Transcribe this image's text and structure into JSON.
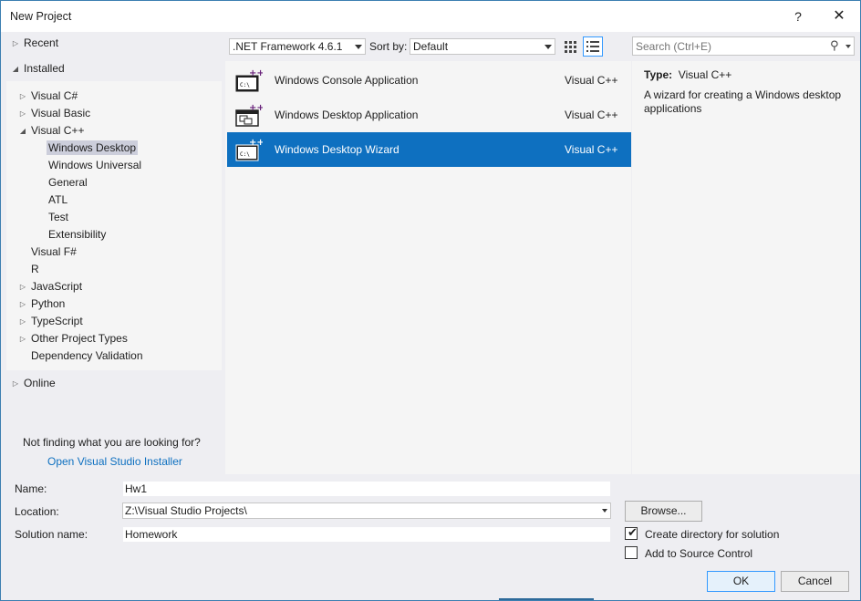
{
  "window": {
    "title": "New Project",
    "help_label": "?",
    "close_label": "✕"
  },
  "left": {
    "recent": "Recent",
    "installed": "Installed",
    "tree": [
      {
        "label": "Visual C#",
        "indent": 0,
        "arrow": "▷"
      },
      {
        "label": "Visual Basic",
        "indent": 0,
        "arrow": "▷"
      },
      {
        "label": "Visual C++",
        "indent": 0,
        "arrow": "◢"
      },
      {
        "label": "Windows Desktop",
        "indent": 1,
        "arrow": "",
        "selected": true
      },
      {
        "label": "Windows Universal",
        "indent": 1,
        "arrow": ""
      },
      {
        "label": "General",
        "indent": 1,
        "arrow": ""
      },
      {
        "label": "ATL",
        "indent": 1,
        "arrow": ""
      },
      {
        "label": "Test",
        "indent": 1,
        "arrow": ""
      },
      {
        "label": "Extensibility",
        "indent": 1,
        "arrow": ""
      },
      {
        "label": "Visual F#",
        "indent": 0,
        "arrow": ""
      },
      {
        "label": "R",
        "indent": 0,
        "arrow": ""
      },
      {
        "label": "JavaScript",
        "indent": 0,
        "arrow": "▷"
      },
      {
        "label": "Python",
        "indent": 0,
        "arrow": "▷"
      },
      {
        "label": "TypeScript",
        "indent": 0,
        "arrow": "▷"
      },
      {
        "label": "Other Project Types",
        "indent": 0,
        "arrow": "▷"
      },
      {
        "label": "Dependency Validation",
        "indent": 0,
        "arrow": ""
      }
    ],
    "online": "Online",
    "not_finding": "Not finding what you are looking for?",
    "installer_link": "Open Visual Studio Installer"
  },
  "toolbar": {
    "framework": ".NET Framework 4.6.1",
    "sort_label": "Sort by:",
    "sort_value": "Default",
    "search_placeholder": "Search (Ctrl+E)"
  },
  "templates": [
    {
      "name": "Windows Console Application",
      "lang": "Visual C++",
      "selected": false
    },
    {
      "name": "Windows Desktop Application",
      "lang": "Visual C++",
      "selected": false
    },
    {
      "name": "Windows Desktop Wizard",
      "lang": "Visual C++",
      "selected": true
    }
  ],
  "info": {
    "type_label": "Type:",
    "type_value": "Visual C++",
    "description": "A wizard for creating a Windows desktop applications"
  },
  "form": {
    "name_label": "Name:",
    "name_value": "Hw1",
    "location_label": "Location:",
    "location_value": "Z:\\Visual Studio Projects\\",
    "solution_label": "Solution name:",
    "solution_value": "Homework",
    "browse_label": "Browse...",
    "create_dir_label": "Create directory for solution",
    "create_dir_checked": true,
    "source_control_label": "Add to Source Control",
    "source_control_checked": false,
    "ok_label": "OK",
    "cancel_label": "Cancel"
  },
  "colors": {
    "accent": "#0e70c0",
    "selection": "#cccedb",
    "link": "#0e70c0",
    "cpp_plus": "#68217a"
  }
}
